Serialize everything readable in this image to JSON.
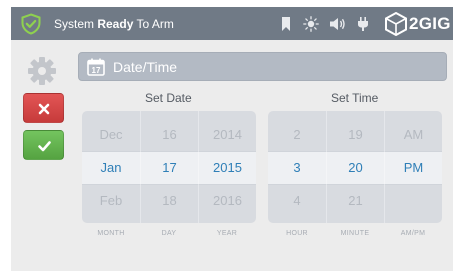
{
  "status": {
    "prefix": "System ",
    "bold": "Ready",
    "suffix": " To Arm",
    "icons": [
      "shield-check-icon",
      "bookmark-icon",
      "brightness-icon",
      "volume-icon",
      "plug-icon"
    ],
    "brand": "2GIG"
  },
  "header": {
    "title": "Date/Time",
    "icon": "calendar-icon",
    "calendar_day": "17"
  },
  "actions": {
    "cancel_icon": "close-icon",
    "confirm_icon": "checkmark-icon"
  },
  "set_date": {
    "label": "Set Date",
    "columns": [
      {
        "label": "MONTH",
        "prev": "Dec",
        "current": "Jan",
        "next": "Feb"
      },
      {
        "label": "DAY",
        "prev": "16",
        "current": "17",
        "next": "18"
      },
      {
        "label": "YEAR",
        "prev": "2014",
        "current": "2015",
        "next": "2016"
      }
    ]
  },
  "set_time": {
    "label": "Set Time",
    "columns": [
      {
        "label": "HOUR",
        "prev": "2",
        "current": "3",
        "next": "4"
      },
      {
        "label": "MINUTE",
        "prev": "19",
        "current": "20",
        "next": "21"
      },
      {
        "label": "AM/PM",
        "prev": "AM",
        "current": "PM",
        "next": ""
      }
    ]
  },
  "colors": {
    "status_bar": "#707a86",
    "accent": "#2f7fb7",
    "cancel": "#d64545",
    "confirm": "#62b34d",
    "shield": "#8fd14f"
  }
}
